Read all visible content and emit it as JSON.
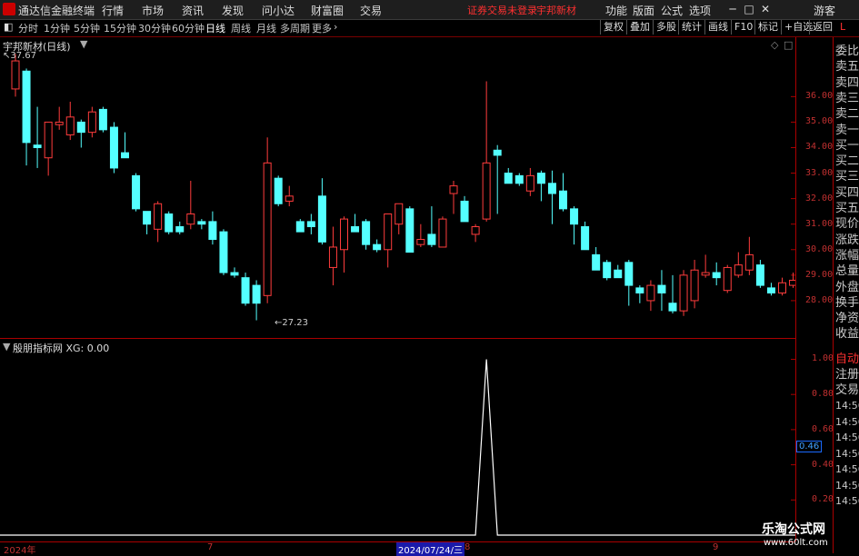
{
  "app": {
    "title": "通达信金融终端"
  },
  "menu": [
    "行情",
    "市场",
    "资讯",
    "发现",
    "问小达",
    "财富圈",
    "交易"
  ],
  "status": {
    "trade_status": "证券交易未登录",
    "stock_name": "宇邦新材"
  },
  "right_menu": [
    "功能",
    "版面",
    "公式",
    "选项"
  ],
  "user": "游客",
  "periods": [
    "分时",
    "1分钟",
    "5分钟",
    "15分钟",
    "30分钟",
    "60分钟",
    "日线",
    "周线",
    "月线",
    "多周期",
    "更多"
  ],
  "active_period": "日线",
  "toolbar_buttons": [
    "复权",
    "叠加",
    "多股",
    "统计",
    "画线",
    "F10",
    "标记",
    "+自选",
    "返回"
  ],
  "main_chart": {
    "title": "宇邦新材(日线)",
    "high_label": "37.67",
    "low_label": "27.23",
    "y_ticks": [
      "36.00",
      "35.00",
      "34.00",
      "33.00",
      "32.00",
      "31.00",
      "30.00",
      "29.00",
      "28.00"
    ]
  },
  "sub_chart": {
    "title": "殷朋指标网 XG: 0.00",
    "y_ticks": [
      "1.00",
      "0.80",
      "0.60",
      "0.40",
      "0.20"
    ],
    "current_value": "0.46"
  },
  "x_axis": {
    "labels": [
      "2024年",
      "7",
      "2024/07/24/三",
      "8",
      "9"
    ]
  },
  "right_panel": {
    "header": "L",
    "items": [
      "委比",
      "卖五",
      "卖四",
      "卖三",
      "卖二",
      "卖一",
      "买一",
      "买二",
      "买三",
      "买四",
      "买五",
      "现价",
      "涨跌",
      "涨幅",
      "总量",
      "外盘",
      "换手",
      "净资",
      "收益"
    ],
    "bottom_items": [
      "自动",
      "注册",
      "交易"
    ],
    "times": [
      "14:56",
      "14:56",
      "14:56",
      "14:56",
      "14:56",
      "14:56",
      "14:56"
    ]
  },
  "watermark": {
    "title": "乐淘公式网",
    "url": "www.60lt.com"
  },
  "colors": {
    "up": "#ff3c3c",
    "down": "#54ffff",
    "grid": "#aa0000",
    "line": "#ffffff"
  },
  "chart_data": {
    "type": "candlestick",
    "ylim": [
      27.0,
      37.9
    ],
    "candles": [
      {
        "o": 36.3,
        "h": 37.67,
        "l": 36.0,
        "c": 37.4
      },
      {
        "o": 37.0,
        "h": 37.1,
        "l": 33.3,
        "c": 34.2
      },
      {
        "o": 34.1,
        "h": 35.6,
        "l": 33.2,
        "c": 34.0
      },
      {
        "o": 33.6,
        "h": 34.8,
        "l": 32.9,
        "c": 35.0
      },
      {
        "o": 34.9,
        "h": 35.6,
        "l": 34.7,
        "c": 35.0
      },
      {
        "o": 34.5,
        "h": 35.8,
        "l": 34.3,
        "c": 35.2
      },
      {
        "o": 35.0,
        "h": 35.1,
        "l": 34.0,
        "c": 34.6
      },
      {
        "o": 34.6,
        "h": 35.6,
        "l": 34.4,
        "c": 35.4
      },
      {
        "o": 35.5,
        "h": 35.6,
        "l": 34.6,
        "c": 34.7
      },
      {
        "o": 34.8,
        "h": 35.0,
        "l": 33.0,
        "c": 33.2
      },
      {
        "o": 33.8,
        "h": 34.6,
        "l": 33.7,
        "c": 33.6
      },
      {
        "o": 32.9,
        "h": 33.0,
        "l": 31.5,
        "c": 31.6
      },
      {
        "o": 31.5,
        "h": 31.5,
        "l": 30.6,
        "c": 31.0
      },
      {
        "o": 30.8,
        "h": 31.9,
        "l": 30.3,
        "c": 31.8
      },
      {
        "o": 31.4,
        "h": 31.5,
        "l": 30.6,
        "c": 30.7
      },
      {
        "o": 30.9,
        "h": 31.1,
        "l": 30.6,
        "c": 30.7
      },
      {
        "o": 31.0,
        "h": 32.7,
        "l": 30.8,
        "c": 31.4
      },
      {
        "o": 31.1,
        "h": 31.2,
        "l": 30.8,
        "c": 31.0
      },
      {
        "o": 31.1,
        "h": 31.5,
        "l": 30.2,
        "c": 30.4
      },
      {
        "o": 30.7,
        "h": 30.8,
        "l": 29.0,
        "c": 29.1
      },
      {
        "o": 29.1,
        "h": 29.3,
        "l": 28.9,
        "c": 29.0
      },
      {
        "o": 28.9,
        "h": 29.1,
        "l": 27.8,
        "c": 27.9
      },
      {
        "o": 28.6,
        "h": 28.8,
        "l": 27.23,
        "c": 27.9
      },
      {
        "o": 28.2,
        "h": 34.4,
        "l": 27.9,
        "c": 33.4
      },
      {
        "o": 32.8,
        "h": 32.9,
        "l": 31.7,
        "c": 31.8
      },
      {
        "o": 31.9,
        "h": 32.5,
        "l": 31.7,
        "c": 32.1
      },
      {
        "o": 31.1,
        "h": 31.2,
        "l": 30.7,
        "c": 30.7
      },
      {
        "o": 31.1,
        "h": 31.4,
        "l": 30.6,
        "c": 30.9
      },
      {
        "o": 32.1,
        "h": 32.8,
        "l": 30.2,
        "c": 30.3
      },
      {
        "o": 29.3,
        "h": 30.9,
        "l": 28.6,
        "c": 30.1
      },
      {
        "o": 30.0,
        "h": 31.3,
        "l": 29.1,
        "c": 31.2
      },
      {
        "o": 30.9,
        "h": 31.4,
        "l": 30.7,
        "c": 30.7
      },
      {
        "o": 31.1,
        "h": 31.2,
        "l": 30.0,
        "c": 30.2
      },
      {
        "o": 30.2,
        "h": 30.4,
        "l": 29.9,
        "c": 30.0
      },
      {
        "o": 30.0,
        "h": 31.0,
        "l": 29.3,
        "c": 31.4
      },
      {
        "o": 31.0,
        "h": 31.8,
        "l": 30.6,
        "c": 31.8
      },
      {
        "o": 31.6,
        "h": 31.7,
        "l": 29.9,
        "c": 29.9
      },
      {
        "o": 30.2,
        "h": 31.0,
        "l": 30.1,
        "c": 30.4
      },
      {
        "o": 30.6,
        "h": 31.7,
        "l": 30.1,
        "c": 30.2
      },
      {
        "o": 30.1,
        "h": 31.3,
        "l": 30.1,
        "c": 31.2
      },
      {
        "o": 32.2,
        "h": 32.7,
        "l": 31.4,
        "c": 32.5
      },
      {
        "o": 31.9,
        "h": 32.1,
        "l": 31.1,
        "c": 31.1
      },
      {
        "o": 30.6,
        "h": 31.0,
        "l": 30.3,
        "c": 30.9
      },
      {
        "o": 31.2,
        "h": 36.6,
        "l": 31.1,
        "c": 33.4
      },
      {
        "o": 33.9,
        "h": 34.1,
        "l": 31.4,
        "c": 33.7
      },
      {
        "o": 33.0,
        "h": 33.2,
        "l": 32.6,
        "c": 32.6
      },
      {
        "o": 32.9,
        "h": 33.0,
        "l": 32.5,
        "c": 32.6
      },
      {
        "o": 32.3,
        "h": 33.2,
        "l": 32.1,
        "c": 32.9
      },
      {
        "o": 33.0,
        "h": 33.1,
        "l": 31.9,
        "c": 32.6
      },
      {
        "o": 32.6,
        "h": 33.1,
        "l": 31.0,
        "c": 32.2
      },
      {
        "o": 32.3,
        "h": 33.0,
        "l": 31.5,
        "c": 31.6
      },
      {
        "o": 31.6,
        "h": 31.7,
        "l": 30.2,
        "c": 31.0
      },
      {
        "o": 30.9,
        "h": 31.1,
        "l": 30.1,
        "c": 30.0
      },
      {
        "o": 29.8,
        "h": 30.1,
        "l": 29.2,
        "c": 29.2
      },
      {
        "o": 29.5,
        "h": 29.6,
        "l": 28.8,
        "c": 28.9
      },
      {
        "o": 29.2,
        "h": 29.4,
        "l": 28.9,
        "c": 28.9
      },
      {
        "o": 29.5,
        "h": 29.6,
        "l": 27.8,
        "c": 28.6
      },
      {
        "o": 28.5,
        "h": 28.6,
        "l": 27.9,
        "c": 28.3
      },
      {
        "o": 28.0,
        "h": 28.8,
        "l": 27.6,
        "c": 28.6
      },
      {
        "o": 28.6,
        "h": 29.2,
        "l": 27.6,
        "c": 28.3
      },
      {
        "o": 27.9,
        "h": 29.0,
        "l": 27.5,
        "c": 27.6
      },
      {
        "o": 27.6,
        "h": 29.2,
        "l": 27.4,
        "c": 29.0
      },
      {
        "o": 28.0,
        "h": 29.6,
        "l": 27.7,
        "c": 29.2
      },
      {
        "o": 29.0,
        "h": 29.8,
        "l": 28.9,
        "c": 29.1
      },
      {
        "o": 29.1,
        "h": 29.5,
        "l": 28.6,
        "c": 28.9
      },
      {
        "o": 28.4,
        "h": 29.4,
        "l": 28.3,
        "c": 29.3
      },
      {
        "o": 29.0,
        "h": 29.9,
        "l": 28.9,
        "c": 29.4
      },
      {
        "o": 29.2,
        "h": 30.5,
        "l": 29.0,
        "c": 29.8
      },
      {
        "o": 29.4,
        "h": 29.6,
        "l": 28.5,
        "c": 28.6
      },
      {
        "o": 28.5,
        "h": 28.7,
        "l": 28.2,
        "c": 28.3
      },
      {
        "o": 28.3,
        "h": 28.9,
        "l": 28.2,
        "c": 28.7
      },
      {
        "o": 28.6,
        "h": 29.1,
        "l": 28.5,
        "c": 28.8
      }
    ],
    "indicator": {
      "name": "XG",
      "ylim": [
        0,
        1.08
      ],
      "peak_index": 43,
      "peak_value": 1.0
    }
  }
}
